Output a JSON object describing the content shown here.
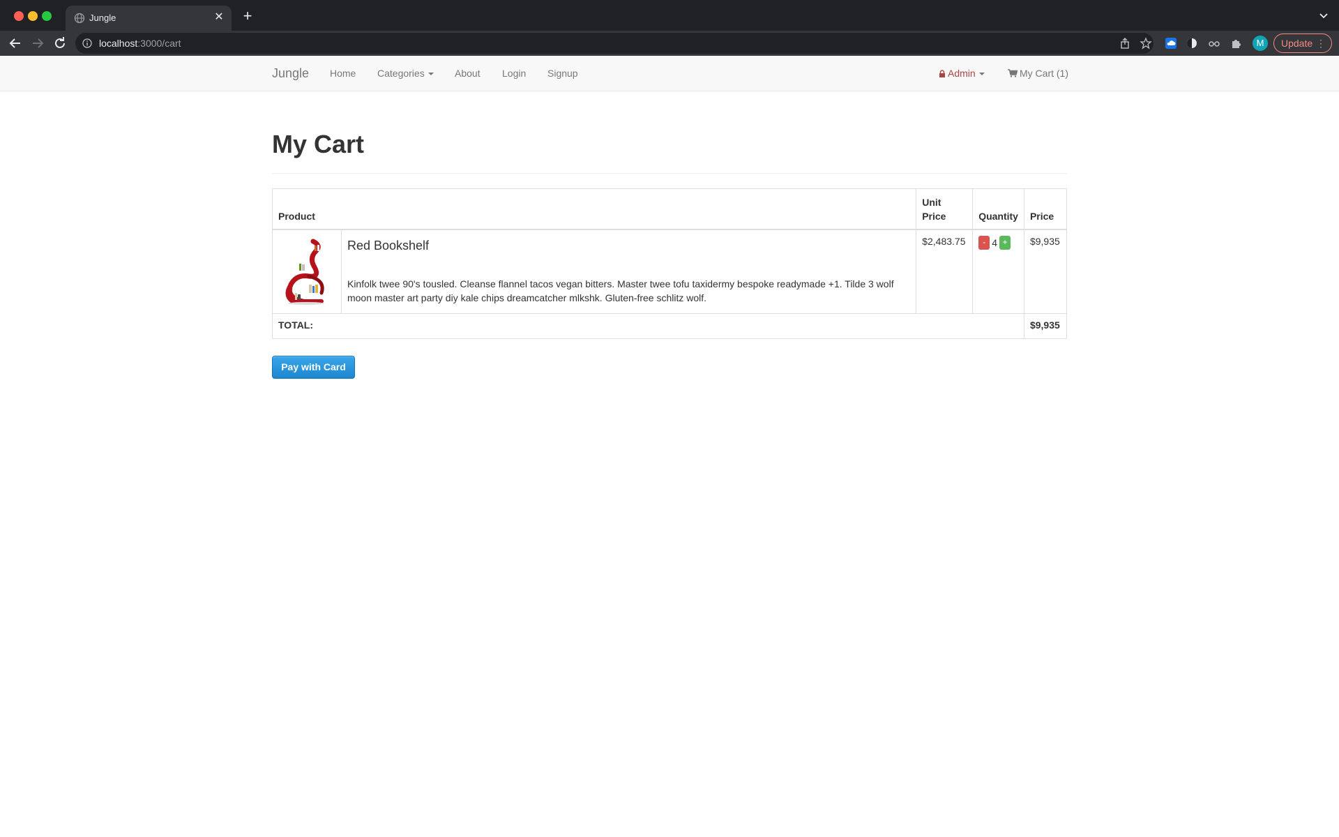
{
  "browser": {
    "tab_title": "Jungle",
    "url_host": "localhost",
    "url_path": ":3000/cart",
    "avatar_letter": "M",
    "update_label": "Update"
  },
  "navbar": {
    "brand": "Jungle",
    "links": [
      "Home",
      "Categories",
      "About",
      "Login",
      "Signup"
    ],
    "admin_label": "Admin",
    "cart_label": "My Cart (1)"
  },
  "page": {
    "title": "My Cart"
  },
  "cart_table": {
    "headers": {
      "product": "Product",
      "unit_price_line1": "Unit",
      "unit_price_line2": "Price",
      "quantity": "Quantity",
      "price": "Price"
    },
    "items": [
      {
        "name": "Red Bookshelf",
        "description": "Kinfolk twee 90's tousled. Cleanse flannel tacos vegan bitters. Master twee tofu taxidermy bespoke readymade +1. Tilde 3 wolf moon master art party diy kale chips dreamcatcher mlkshk. Gluten-free schlitz wolf.",
        "unit_price": "$2,483.75",
        "quantity": "4",
        "minus_label": "-",
        "plus_label": "+",
        "price": "$9,935"
      }
    ],
    "total_label": "TOTAL:",
    "total_value": "$9,935"
  },
  "actions": {
    "pay_label": "Pay with Card"
  },
  "colors": {
    "chrome_dark": "#202124",
    "toolbar": "#35363a",
    "navbar_bg": "#f8f8f8",
    "admin_red": "#a94442",
    "minus_red": "#d9534f",
    "plus_green": "#5cb85c",
    "pay_blue": "#1d87d0"
  }
}
